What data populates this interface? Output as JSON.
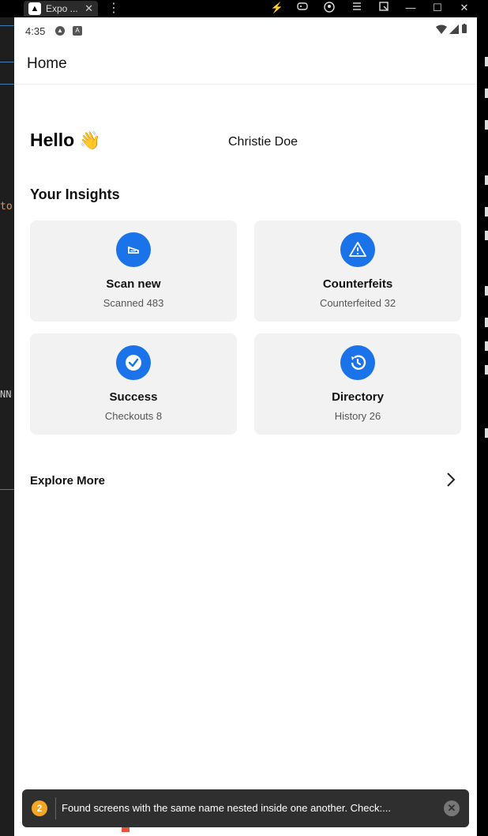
{
  "emulator": {
    "tab_label": "Expo ...",
    "tab_close": "✕",
    "menu_glyph": "⋮",
    "controls": [
      "⚡",
      "🎮",
      "◉",
      "☰",
      "⤢",
      "—",
      "☐",
      "✕"
    ]
  },
  "ide": {
    "text_a": "to",
    "text_b": "NN"
  },
  "status_bar": {
    "time": "4:35",
    "icons": [
      "expo-icon",
      "a-icon"
    ],
    "right_icons": [
      "wifi-icon",
      "signal-icon",
      "battery-icon"
    ]
  },
  "appbar": {
    "title": "Home"
  },
  "greeting": {
    "hello": "Hello",
    "emoji": "👋",
    "username": "Christie Doe"
  },
  "insights": {
    "heading": "Your Insights",
    "cards": [
      {
        "title": "Scan new",
        "subtitle": "Scanned 483",
        "icon": "scanner-icon"
      },
      {
        "title": "Counterfeits",
        "subtitle": "Counterfeited 32",
        "icon": "warning-icon"
      },
      {
        "title": "Success",
        "subtitle": "Checkouts 8",
        "icon": "check-circle-icon"
      },
      {
        "title": "Directory",
        "subtitle": "History 26",
        "icon": "history-icon"
      }
    ]
  },
  "explore": {
    "label": "Explore More",
    "icon": "chevron-right-icon"
  },
  "toast": {
    "count": "2",
    "message": "Found screens with the same name nested inside one another. Check:...",
    "close": "✕"
  },
  "colors": {
    "accent": "#1a73e8",
    "card_bg": "#f2f2f2",
    "toast_bg": "#2f2f2f",
    "badge": "#f5a623"
  }
}
